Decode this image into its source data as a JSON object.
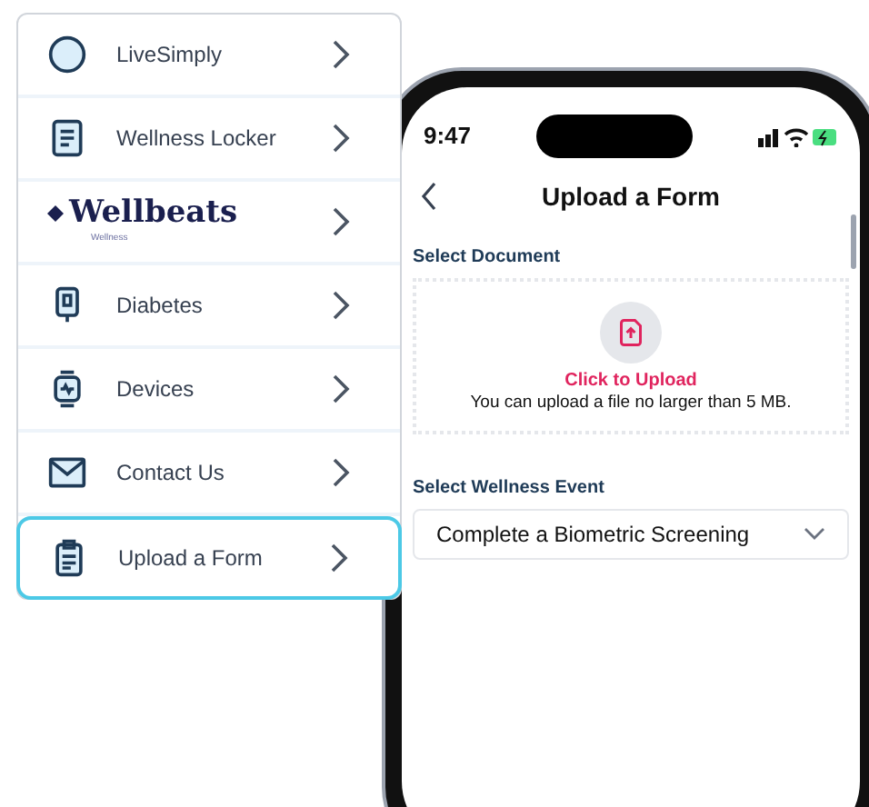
{
  "menu": {
    "items": [
      {
        "kind": "icon",
        "label": "LiveSimply",
        "selected": false
      },
      {
        "kind": "icon",
        "label": "Wellness Locker",
        "selected": false
      },
      {
        "kind": "logo",
        "label": "Wellbeats",
        "sublabel": "Wellness",
        "selected": false
      },
      {
        "kind": "icon",
        "label": "Diabetes",
        "selected": false
      },
      {
        "kind": "icon",
        "label": "Devices",
        "selected": false
      },
      {
        "kind": "icon",
        "label": "Contact Us",
        "selected": false
      },
      {
        "kind": "icon",
        "label": "Upload a Form",
        "selected": true
      }
    ]
  },
  "phone": {
    "status_bar": {
      "time": "9:47"
    },
    "header": {
      "title": "Upload a Form"
    },
    "document": {
      "label": "Select Document",
      "action": "Click to Upload",
      "hint": "You can upload a file no larger than 5 MB."
    },
    "event": {
      "label": "Select Wellness Event",
      "value": "Complete a Biometric Screening"
    }
  }
}
